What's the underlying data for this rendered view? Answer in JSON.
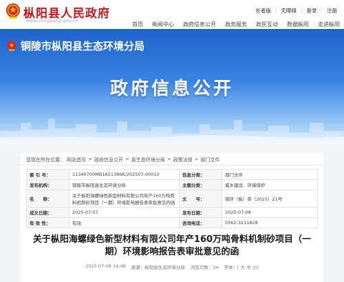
{
  "header": {
    "site_title": "枞阳县人民政府",
    "site_url": "www.zongyang.gov.cn",
    "util": [
      "长者版",
      "无障碍",
      "登录",
      "注册"
    ],
    "nav": [
      "首页",
      "新闻中心",
      "政府信息公开",
      "政务服务",
      "政民互动",
      "数据枞阳",
      "走进枞阳"
    ]
  },
  "banner": {
    "bureau_name": "铜陵市枞阳县生态环境分局",
    "title": "政府信息公开"
  },
  "breadcrumb": {
    "prefix": "您现在所在位置：",
    "items": [
      "网站首页",
      "政府信息公开",
      "县生态环境分局",
      "政策法规",
      "部门文件"
    ],
    "separator": ">"
  },
  "info_table": {
    "rows": [
      {
        "k1": "索 引 号：",
        "v1": "11340700MB1A51386K/202507-00010",
        "k2": "信息分类：",
        "v2": "部门文件"
      },
      {
        "k1": "发布机构：",
        "v1": "铜陵市枞阳县生态环境分局",
        "k2": "主题分类：",
        "v2": "城乡建设、环境保护"
      },
      {
        "k1": "名　　称：",
        "v1": "关于枞阳海螺绿色新型材料有限公司年产160万吨骨料机制砂项目（一期）环境影响报告表审批意见的函",
        "k2": "文　　号：",
        "v2": "铜环（枞）审〔2025〕21号"
      },
      {
        "k1": "成文日期：",
        "v1": "2025-07-07",
        "k2": "发布日期：",
        "v2": "2025-07-08"
      },
      {
        "k1": "有 效 性：",
        "v1": "有效",
        "k2": "咨询电话：",
        "v2": "0562-3211828"
      }
    ]
  },
  "article": {
    "title_line1": "关于枞阳海螺绿色新型材料有限公司年产160万吨骨料机制砂项目（一",
    "title_line2": "期）环境影响报告表审批意见的函",
    "date": "2025-07-08 14:48",
    "source_label": "来源：",
    "source": "枞阳县生态环境分局",
    "views_label": "浏览次数：",
    "views": "24",
    "font_label": "字体：",
    "font_sizes": [
      "大",
      "中",
      "小"
    ]
  },
  "colors": {
    "brand_red": "#c4161c",
    "banner_blue": "#1f63c9"
  }
}
